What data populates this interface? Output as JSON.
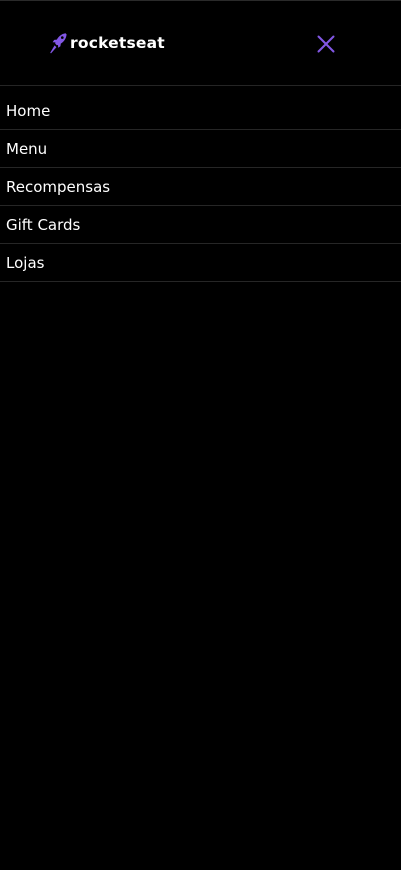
{
  "header": {
    "logo": {
      "text": "rocketseat",
      "icon": "rocket-icon"
    },
    "close": {
      "icon": "close-icon"
    }
  },
  "nav": {
    "items": [
      {
        "label": "Home"
      },
      {
        "label": "Menu"
      },
      {
        "label": "Recompensas"
      },
      {
        "label": "Gift Cards"
      },
      {
        "label": "Lojas"
      }
    ]
  },
  "colors": {
    "background": "#000000",
    "text": "#ffffff",
    "accent": "#8257e5",
    "divider": "#262626"
  }
}
